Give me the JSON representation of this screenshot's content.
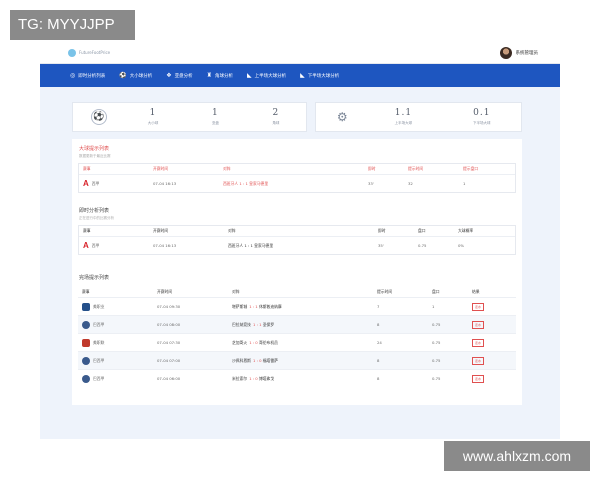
{
  "watermarks": {
    "top": "TG: MYYJJPP",
    "bottom": "www.ahlxzm.com"
  },
  "header": {
    "logo_text": "FutureFootPrice",
    "user_name": "系统管理员"
  },
  "nav": [
    {
      "icon": "globe-icon",
      "label": "即时分析列表"
    },
    {
      "icon": "football-icon",
      "label": "大小球分析"
    },
    {
      "icon": "handshake-icon",
      "label": "亚盘分析"
    },
    {
      "icon": "trophy-icon",
      "label": "角球分析"
    },
    {
      "icon": "half-icon",
      "label": "上半场大球分析"
    },
    {
      "icon": "half-icon",
      "label": "下半场大球分析"
    }
  ],
  "stats_left": [
    {
      "value": "1",
      "label": "大小球"
    },
    {
      "value": "1",
      "label": "亚盘"
    },
    {
      "value": "2",
      "label": "角球"
    }
  ],
  "stats_right": [
    {
      "value": "1.1",
      "label": "上半场大球"
    },
    {
      "value": "0.1",
      "label": "下半场大球"
    }
  ],
  "section1": {
    "title": "大球提示列表",
    "subtitle": "数据更新于最近比赛",
    "headers": [
      "赛事",
      "开赛时间",
      "对阵",
      "即时",
      "提示时间",
      "提示盘口"
    ],
    "rows": [
      {
        "league": "西甲",
        "time": "07-04 16:13",
        "home": "西班牙人",
        "score": "1 : 1",
        "away": "皇家马德里",
        "live": "33'",
        "hint_time": "32",
        "line": "1"
      }
    ]
  },
  "section2": {
    "title": "即时分析列表",
    "subtitle": "正在进行中的比赛分析",
    "headers": [
      "赛事",
      "开赛时间",
      "对阵",
      "即时",
      "盘口",
      "大球概率"
    ],
    "rows": [
      {
        "league": "西甲",
        "time": "07-04 16:13",
        "home": "西班牙人",
        "score": "1 : 1",
        "away": "皇家马德里",
        "live": "35'",
        "line": "0.75",
        "prob": "0%"
      }
    ]
  },
  "section3": {
    "title": "完场提示列表",
    "headers": [
      "赛事",
      "开赛时间",
      "对阵",
      "提示时间",
      "盘口",
      "结果"
    ],
    "rows": [
      {
        "league": "美职业",
        "time": "07-04 09:30",
        "home": "堪萨斯城",
        "score": "1 : 1",
        "away": "休斯敦迪纳摩",
        "hint": "7",
        "line": "1",
        "result": "走水"
      },
      {
        "league": "巴西甲",
        "time": "07-04 08:00",
        "home": "巴拉纳竞技",
        "score": "1 : 1",
        "away": "圣保罗",
        "hint": "8",
        "line": "0.75",
        "result": "走水"
      },
      {
        "league": "美职联",
        "time": "07-04 07:30",
        "home": "芝加哥火",
        "score": "1 : 0",
        "away": "哥伦布机员",
        "hint": "24",
        "line": "0.75",
        "result": "走水"
      },
      {
        "league": "巴西甲",
        "time": "07-04 07:00",
        "home": "沙佩科恩斯",
        "score": "1 : 0",
        "away": "福塔雷萨",
        "hint": "8",
        "line": "0.75",
        "result": "走水"
      },
      {
        "league": "巴西甲",
        "time": "07-04 06:00",
        "home": "米拉索尔",
        "score": "1 : 0",
        "away": "博塔弗戈",
        "hint": "8",
        "line": "0.75",
        "result": "走水"
      }
    ]
  }
}
